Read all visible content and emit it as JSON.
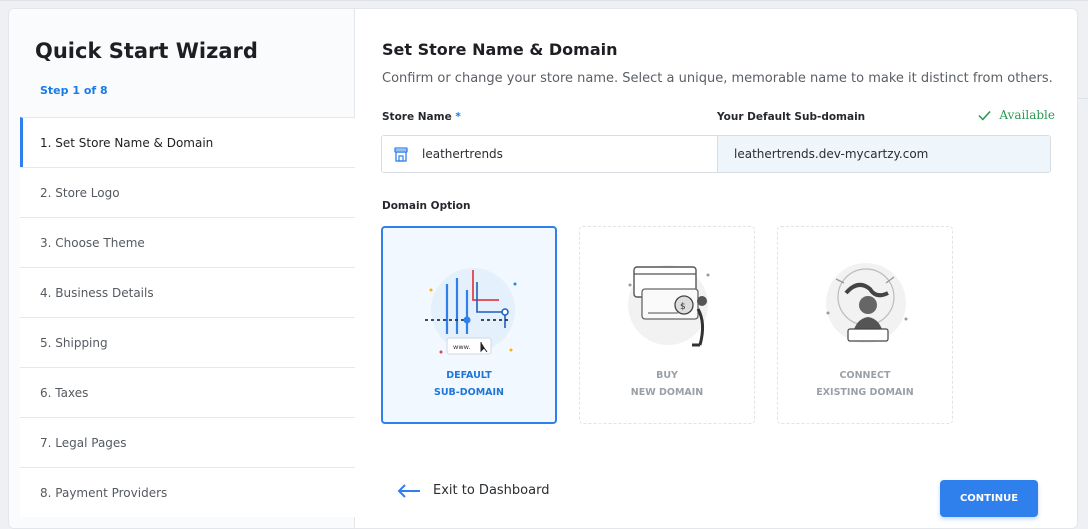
{
  "sidebar": {
    "title": "Quick Start Wizard",
    "step_indicator": "Step 1 of 8",
    "steps": [
      {
        "label": "1. Set Store Name & Domain"
      },
      {
        "label": "2. Store Logo"
      },
      {
        "label": "3. Choose Theme"
      },
      {
        "label": "4. Business Details"
      },
      {
        "label": "5. Shipping"
      },
      {
        "label": "6. Taxes"
      },
      {
        "label": "7. Legal Pages"
      },
      {
        "label": "8. Payment Providers"
      }
    ]
  },
  "main": {
    "title": "Set Store Name & Domain",
    "subtitle": "Confirm or change your store name. Select a unique, memorable name to make it distinct from others.",
    "store_name_label": "Store Name",
    "required_mark": "*",
    "store_name_value": "leathertrends",
    "subdomain_label": "Your Default Sub-domain",
    "subdomain_value": "leathertrends.dev-mycartzy.com",
    "availability": "Available",
    "domain_option_label": "Domain Option",
    "options": [
      {
        "line1": "DEFAULT",
        "line2": "SUB-DOMAIN"
      },
      {
        "line1": "BUY",
        "line2": "NEW DOMAIN"
      },
      {
        "line1": "CONNECT",
        "line2": "EXISTING DOMAIN"
      }
    ],
    "exit_label": "Exit to Dashboard",
    "continue_label": "CONTINUE"
  },
  "colors": {
    "accent": "#2f80ed",
    "available": "#2a9a55"
  }
}
